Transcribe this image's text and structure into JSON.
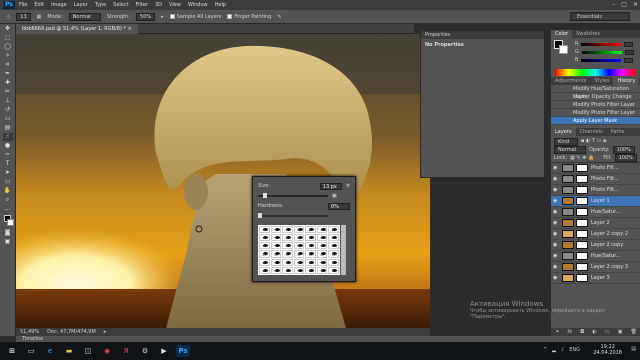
{
  "app": {
    "logo": "Ps",
    "menu": [
      "File",
      "Edit",
      "Image",
      "Layer",
      "Type",
      "Select",
      "Filter",
      "3D",
      "View",
      "Window",
      "Help"
    ]
  },
  "options": {
    "brush_size": "13",
    "mode_label": "Mode:",
    "mode_value": "Normal",
    "strength_label": "Strength:",
    "strength_value": "50%",
    "sample_all": "Sample All Layers",
    "finger_painting": "Finger Painting",
    "workspace": "Essentials"
  },
  "document": {
    "tab": "bbb6666.psd @ 51,4% (Layer 1, RGB/8) *",
    "zoom": "51,49%",
    "doc_info": "Doc: 47,7M/474,9M",
    "timeline": "Timeline"
  },
  "properties": {
    "tab": "Properties",
    "body": "No Properties"
  },
  "color_panel": {
    "tabs": [
      "Color",
      "Swatches"
    ],
    "channels": [
      "R",
      "G",
      "B"
    ]
  },
  "adjust_tabs": [
    "Adjustments",
    "Styles",
    "History"
  ],
  "history": [
    "Modify Hue/Saturation Layer",
    "Master Opacity Change",
    "Modify Photo Filter Layer",
    "Modify Photo Filter Layer",
    "Apply Layer Mask"
  ],
  "layers_panel": {
    "tabs": [
      "Layers",
      "Channels",
      "Paths"
    ],
    "kind": "Kind",
    "blend": "Normal",
    "opacity_label": "Opacity:",
    "opacity": "100%",
    "lock_label": "Lock:",
    "fill_label": "Fill:",
    "fill": "100%"
  },
  "layers": [
    {
      "name": "Photo Filt...",
      "type": "adj",
      "selected": false
    },
    {
      "name": "Photo Filt...",
      "type": "adj",
      "selected": false
    },
    {
      "name": "Photo Filt...",
      "type": "adj",
      "selected": false
    },
    {
      "name": "Layer 1",
      "type": "img",
      "selected": true
    },
    {
      "name": "Hue/Satur...",
      "type": "adj",
      "selected": false
    },
    {
      "name": "Layer 2",
      "type": "img",
      "selected": false
    },
    {
      "name": "Layer 2 copy 2",
      "type": "img",
      "selected": false
    },
    {
      "name": "Layer 2 copy",
      "type": "img",
      "selected": false
    },
    {
      "name": "Hue/Satur...",
      "type": "adj",
      "selected": false
    },
    {
      "name": "Layer 2 copy 3",
      "type": "img",
      "selected": false
    },
    {
      "name": "Layer 3",
      "type": "img",
      "selected": false
    }
  ],
  "brush_panel": {
    "size_label": "Size:",
    "size_value": "13 px",
    "hardness_label": "Hardness:",
    "hardness_value": "0%",
    "hardness": 0.0,
    "size": 0.08
  },
  "brush_presets": [
    "30",
    "30",
    "30",
    "25",
    "25",
    "36",
    "25",
    "36",
    "36",
    "32",
    "25",
    "50",
    "25",
    "50",
    "36",
    "36",
    "50",
    "50",
    "50",
    "36",
    "32",
    "25",
    "36",
    "50",
    "32",
    "36",
    "50",
    "32",
    "25",
    "32",
    "36",
    "50",
    "26",
    "50",
    "32",
    "25",
    "17",
    "30",
    "38",
    "18",
    "38",
    "14"
  ],
  "watermark": {
    "line1": "Активация Windows",
    "line2": "Чтобы активировать Windows, перейдите в раздел \"Параметры\"."
  },
  "taskbar": {
    "lang": "ENG",
    "time": "19:22",
    "date": "24.04.2018"
  },
  "colors": {
    "menubar": "#3c3c3c",
    "panel": "#535353",
    "selection": "#3f74b8"
  }
}
